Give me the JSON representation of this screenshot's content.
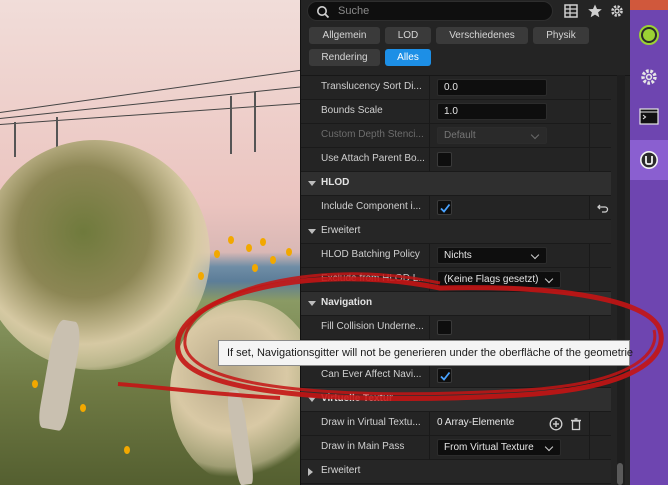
{
  "search": {
    "placeholder": "Suche"
  },
  "toolbar_icons": [
    "table-icon",
    "star-icon",
    "gear-icon"
  ],
  "filters": [
    {
      "label": "Allgemein",
      "active": false
    },
    {
      "label": "LOD",
      "active": false
    },
    {
      "label": "Verschiedenes",
      "active": false
    },
    {
      "label": "Physik",
      "active": false
    },
    {
      "label": "Rendering",
      "active": false
    },
    {
      "label": "Alles",
      "active": true
    }
  ],
  "properties": {
    "translucency_sort": {
      "label": "Translucency Sort Di...",
      "value": "0.0"
    },
    "bounds_scale": {
      "label": "Bounds Scale",
      "value": "1.0"
    },
    "custom_depth": {
      "label": "Custom Depth Stenci...",
      "value": "Default"
    },
    "use_attach_parent": {
      "label": "Use Attach Parent Bo..."
    },
    "hlod_section": {
      "label": "HLOD"
    },
    "include_component": {
      "label": "Include Component i..."
    },
    "erweitert_1": {
      "label": "Erweitert"
    },
    "hlod_batching": {
      "label": "HLOD Batching Policy",
      "value": "Nichts"
    },
    "exclude_hlod": {
      "label": "Exclude from HLOD L...",
      "value": "(Keine Flags gesetzt)"
    },
    "navigation_section": {
      "label": "Navigation"
    },
    "fill_collision": {
      "label": "Fill Collision Underne..."
    },
    "can_ever_affect": {
      "label": "Can Ever Affect Navi..."
    },
    "virtuelle_textur": {
      "label": "Virtuelle Textur"
    },
    "draw_virtual": {
      "label": "Draw in Virtual Textu...",
      "value": "0 Array-Elemente"
    },
    "draw_main_pass": {
      "label": "Draw in Main Pass",
      "value": "From Virtual Texture"
    },
    "erweitert_2": {
      "label": "Erweitert"
    }
  },
  "tooltip": {
    "text": "If set, Navigationsgitter will not be generieren under the oberfläche of the geometrie"
  },
  "sidebar": {
    "items": [
      "b-logo-icon",
      "gear-icon",
      "terminal-icon",
      "unreal-logo-icon"
    ]
  },
  "colors": {
    "accent": "#1d8fe6",
    "sidebar": "#6e45b0",
    "annotation": "#c41414"
  }
}
